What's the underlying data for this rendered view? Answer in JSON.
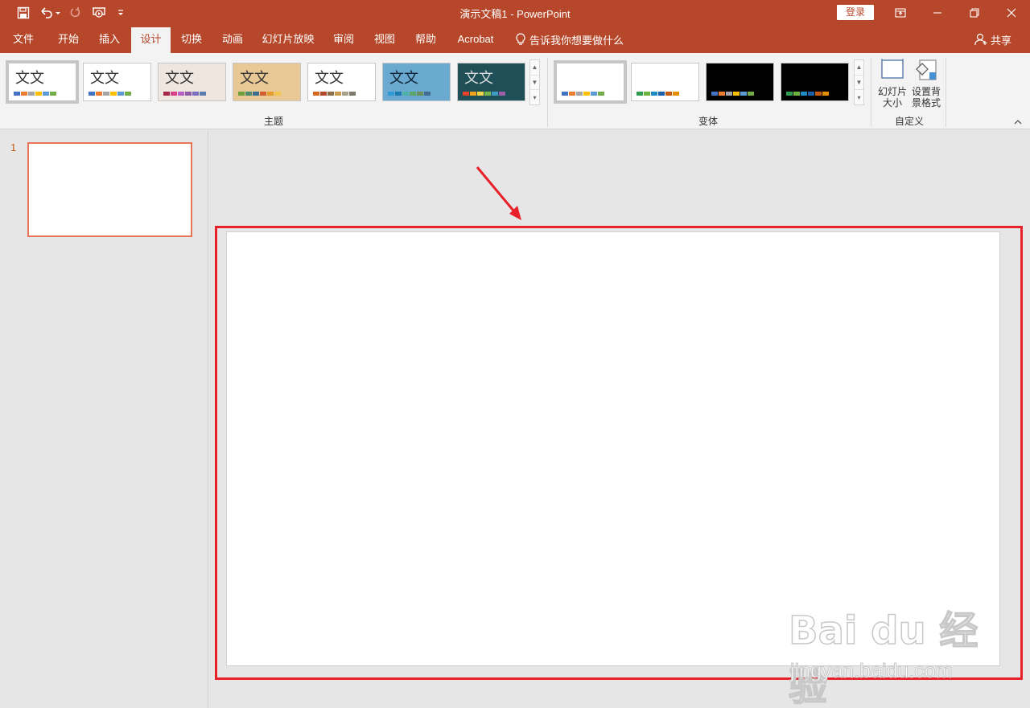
{
  "app": {
    "title": "演示文稿1  -  PowerPoint",
    "login_label": "登录"
  },
  "tabs": [
    {
      "label": "文件"
    },
    {
      "label": "开始"
    },
    {
      "label": "插入"
    },
    {
      "label": "设计",
      "active": true
    },
    {
      "label": "切换"
    },
    {
      "label": "动画"
    },
    {
      "label": "幻灯片放映"
    },
    {
      "label": "审阅"
    },
    {
      "label": "视图"
    },
    {
      "label": "帮助"
    },
    {
      "label": "Acrobat"
    }
  ],
  "tell_me": "告诉我你想要做什么",
  "share": "共享",
  "ribbon": {
    "themes_group": "主题",
    "variants_group": "变体",
    "customize_group": "自定义",
    "theme_sample_text": "文文",
    "slide_size_label": "幻灯片大小",
    "bg_format_label": "设置背景格式"
  },
  "themes": [
    {
      "bg": "#ffffff",
      "colors": [
        "#4472c4",
        "#ed7d31",
        "#a5a5a5",
        "#ffc000",
        "#5b9bd5",
        "#70ad47"
      ]
    },
    {
      "bg": "#ffffff",
      "colors": [
        "#4472c4",
        "#ed7d31",
        "#a5a5a5",
        "#ffc000",
        "#5b9bd5",
        "#70ad47"
      ]
    },
    {
      "bg": "#efe6e0",
      "colors": [
        "#a5254b",
        "#d5408a",
        "#b55fc7",
        "#8e5ca9",
        "#7a6fbf",
        "#5b7fb1"
      ]
    },
    {
      "bg": "#e8c895",
      "colors": [
        "#6f9e3f",
        "#4f8a6d",
        "#3a6f8f",
        "#d25b2f",
        "#e59c2d",
        "#f1c54d"
      ]
    },
    {
      "bg": "#ffffff",
      "colors": [
        "#d46a1f",
        "#b24a2a",
        "#8e6f4a",
        "#c89b4f",
        "#a8a08a",
        "#7e7869"
      ]
    },
    {
      "bg": "#6aaad0",
      "colors": [
        "#2e9bd6",
        "#1b7bb0",
        "#4fb0a6",
        "#5ba56b",
        "#6b8f5a",
        "#3f6c8f"
      ]
    },
    {
      "bg": "#1f4f57",
      "colors": [
        "#e8402a",
        "#f0a21b",
        "#f3d34a",
        "#78b84a",
        "#3d9dc7",
        "#9e5fa8"
      ]
    }
  ],
  "variants": [
    {
      "dark": false,
      "colors": [
        "#4472c4",
        "#ed7d31",
        "#a5a5a5",
        "#ffc000",
        "#5b9bd5",
        "#70ad47"
      ]
    },
    {
      "dark": false,
      "colors": [
        "#2e9e4d",
        "#6cb33f",
        "#1f8ac4",
        "#1b5fa8",
        "#c55a11",
        "#e58f00"
      ]
    },
    {
      "dark": true,
      "colors": [
        "#4472c4",
        "#ed7d31",
        "#a5a5a5",
        "#ffc000",
        "#5b9bd5",
        "#70ad47"
      ]
    },
    {
      "dark": true,
      "colors": [
        "#2e9e4d",
        "#6cb33f",
        "#1f8ac4",
        "#1b5fa8",
        "#c55a11",
        "#e58f00"
      ]
    }
  ],
  "slides": [
    {
      "number": "1"
    }
  ],
  "watermark": {
    "logo": "Bai du 经验",
    "url": "jingyan.baidu.com"
  }
}
